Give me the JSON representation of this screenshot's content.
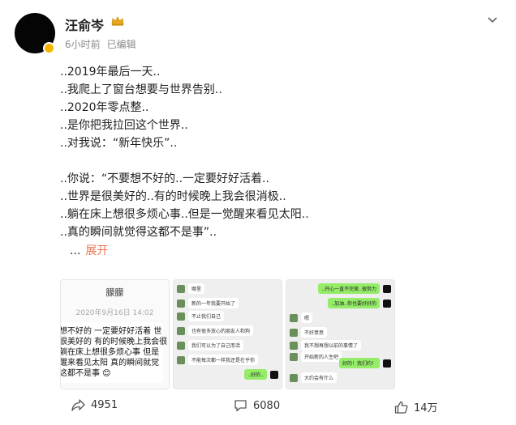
{
  "post": {
    "username": "汪俞岑",
    "time": "6小时前",
    "edited": "已编辑",
    "lines": [
      "..2019年最后一天..",
      "..我爬上了窗台想要与世界告别..",
      "..2020年零点整..",
      "..是你把我拉回这个世界..",
      "..对我说：“新年快乐”.."
    ],
    "lines2": [
      "..你说：“不要想不好的..一定要好好活着..",
      "..世界是很美好的..有的时候晚上我会很消极..",
      "..躺在床上想很多烦心事..但是一觉醒来看见太阳..",
      "..真的瞬间就觉得这都不是事”.."
    ],
    "ellipsis": "...",
    "expand_label": "展开"
  },
  "images": {
    "img1": {
      "name": "朦朦",
      "date": "2020年9月16日 14:02",
      "bubble_lines": [
        "想不好的 一定要好好活着 世",
        "很美好的 有的时候晚上我会很",
        "躺在床上想很多烦心事 但是",
        "醒来看见太阳 真的瞬间就觉",
        "这都不是事 😊"
      ]
    },
    "img2": {
      "messages": [
        {
          "text": "哪里"
        },
        {
          "text": "新的一年我要开始了"
        },
        {
          "text": "不止我们自己"
        },
        {
          "text": "也有很多放心的朋友人和狗"
        },
        {
          "text": "我们可以为了自己而活"
        },
        {
          "text": "不能每次都一样我还是在乎你"
        }
      ],
      "reply": "..好的.."
    },
    "img3": {
      "top": "..开心一直不完美..很努力",
      "second": "..加油..你也要好好的",
      "messages": [
        {
          "text": "嗯"
        },
        {
          "text": "不好意思"
        },
        {
          "text": "我不想再想以前的事情了"
        },
        {
          "text": "开始新的人生吧"
        },
        {
          "text": "我们一直都在"
        }
      ],
      "reply": "好的！我们约！",
      "last": "大约会有什么"
    }
  },
  "footer": {
    "share_count": "4951",
    "comment_count": "6080",
    "like_count": "14万"
  },
  "colors": {
    "link": "#eb7350",
    "meta": "#8a8a8a",
    "badge": "#f7b500"
  }
}
